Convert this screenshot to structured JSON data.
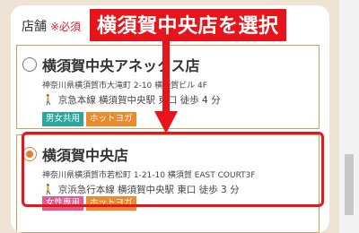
{
  "colors": {
    "accent_red": "#e8141c",
    "radio_orange": "#e07e36",
    "card_border": "#c9a35c",
    "tag_teal": "#2ca79e",
    "tag_orange": "#ee8a2e",
    "tag_pink": "#e25b8f"
  },
  "section": {
    "label": "店舗",
    "required": "※必須"
  },
  "annotation": {
    "callout": "横須賀中央店を選択"
  },
  "stores": [
    {
      "name": "横須賀中央アネックス店",
      "selected": false,
      "address": "神奈川県横須賀市大滝町 2-10 横須賀ビル 4F",
      "access": "京急本線 横須賀中央駅 東口 徒歩 4 分",
      "tags": [
        "男女共用",
        "ホットヨガ"
      ]
    },
    {
      "name": "横須賀中央店",
      "selected": true,
      "address": "神奈川県横須賀市若松町 1-21-10 横須賀 EAST COURT3F",
      "access": "京浜急行本線 横須賀中央駅 東口 徒歩 3 分",
      "tags": [
        "女性専用",
        "ホットヨガ"
      ]
    }
  ],
  "icons": {
    "walker": "walking-person-icon"
  }
}
